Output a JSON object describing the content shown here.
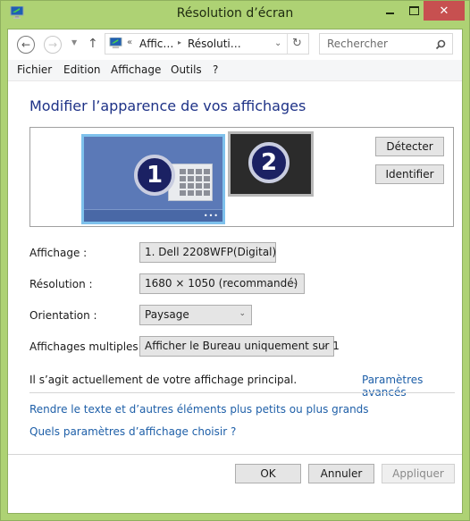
{
  "window": {
    "title": "Résolution d’écran",
    "controls": {
      "minimize": "_",
      "maximize": "□",
      "close": "✕"
    },
    "colors": {
      "frame": "#aed274",
      "close_button": "#c75050",
      "link": "#1e5fa8",
      "heading": "#1e3287"
    }
  },
  "navigation": {
    "back_icon": "←",
    "forward_icon": "→",
    "recent_icon": "▼",
    "up_icon": "↑",
    "address": {
      "separator": "«",
      "crumbs": [
        "Affic…",
        "Résoluti…"
      ],
      "crumb_arrow": "▸",
      "dropdown_icon": "⌄",
      "refresh_icon": "↻"
    },
    "search": {
      "placeholder": "Rechercher",
      "icon": "⚲"
    }
  },
  "menu": [
    "Fichier",
    "Edition",
    "Affichage",
    "Outils",
    "?"
  ],
  "main": {
    "heading": "Modifier l’apparence de vos affichages",
    "monitors": [
      {
        "number": "1",
        "selected": true
      },
      {
        "number": "2",
        "selected": false
      }
    ],
    "taskbar_dots": "•••",
    "buttons": {
      "detect": "Détecter",
      "identify": "Identifier"
    },
    "fields": [
      {
        "label": "Affichage :",
        "value": "1. Dell 2208WFP(Digital)"
      },
      {
        "label": "Résolution :",
        "value": "1680 × 1050 (recommandé)"
      },
      {
        "label": "Orientation :",
        "value": "Paysage"
      },
      {
        "label": "Affichages multiples :",
        "value": "Afficher le Bureau uniquement sur 1"
      }
    ],
    "dropdown_arrow": "⌄",
    "status": "Il s’agit actuellement de votre affichage principal.",
    "advanced_link": "Paramètres avancés",
    "links": [
      "Rendre le texte et d’autres éléments plus petits ou plus grands",
      "Quels paramètres d’affichage choisir ?"
    ]
  },
  "footer": {
    "ok": "OK",
    "cancel": "Annuler",
    "apply": "Appliquer"
  }
}
